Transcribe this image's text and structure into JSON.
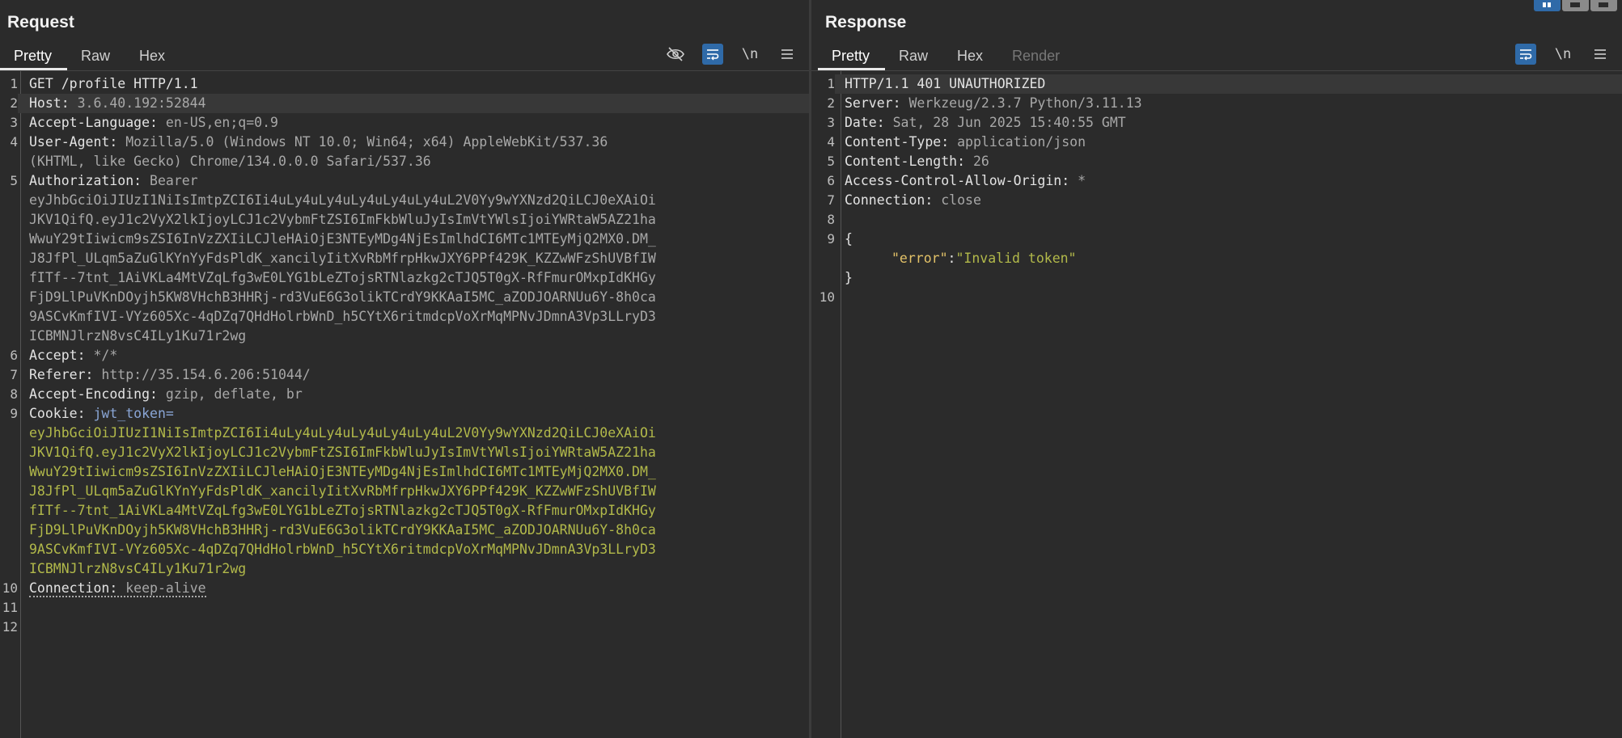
{
  "request": {
    "title": "Request",
    "tabs": [
      "Pretty",
      "Raw",
      "Hex"
    ],
    "active_tab": "Pretty",
    "lines": {
      "l1": "GET /profile HTTP/1.1",
      "l2_name": "Host: ",
      "l2_val": "3.6.40.192:52844",
      "l3_name": "Accept-Language: ",
      "l3_val": "en-US,en;q=0.9",
      "l4_name": "User-Agent: ",
      "l4_val_a": "Mozilla/5.0 (Windows NT 10.0; Win64; x64) AppleWebKit/537.36",
      "l4_val_b": "(KHTML, like Gecko) Chrome/134.0.0.0 Safari/537.36",
      "l5_name": "Authorization: ",
      "l5_val": "Bearer",
      "l5_token": [
        "eyJhbGciOiJIUzI1NiIsImtpZCI6Ii4uLy4uLy4uLy4uLy4uLy4uL2V0Yy9wYXNzd2QiLCJ0eXAiOi",
        "JKV1QifQ.eyJ1c2VyX2lkIjoyLCJ1c2VybmFtZSI6ImFkbWluJyIsImVtYWlsIjoiYWRtaW5AZ21ha",
        "WwuY29tIiwicm9sZSI6InVzZXIiLCJleHAiOjE3NTEyMDg4NjEsImlhdCI6MTc1MTEyMjQ2MX0.DM_",
        "J8JfPl_ULqm5aZuGlKYnYyFdsPldK_xancilyIitXvRbMfrpHkwJXY6PPf429K_KZZwWFzShUVBfIW",
        "fITf--7tnt_1AiVKLa4MtVZqLfg3wE0LYG1bLeZTojsRTNlazkg2cTJQ5T0gX-RfFmurOMxpIdKHGy",
        "FjD9LlPuVKnDOyjh5KW8VHchB3HHRj-rd3VuE6G3olikTCrdY9KKAaI5MC_aZODJOARNUu6Y-8h0ca",
        "9ASCvKmfIVI-VYz605Xc-4qDZq7QHdHolrbWnD_h5CYtX6ritmdcpVoXrMqMPNvJDmnA3Vp3LLryD3",
        "ICBMNJlrzN8vsC4ILy1Ku71r2wg"
      ],
      "l6_name": "Accept: ",
      "l6_val": "*/*",
      "l7_name": "Referer: ",
      "l7_val": "http://35.154.6.206:51044/",
      "l8_name": "Accept-Encoding: ",
      "l8_val": "gzip, deflate, br",
      "l9_name": "Cookie: ",
      "l9_cookie": "jwt_token=",
      "l9_token": [
        "eyJhbGciOiJIUzI1NiIsImtpZCI6Ii4uLy4uLy4uLy4uLy4uLy4uL2V0Yy9wYXNzd2QiLCJ0eXAiOi",
        "JKV1QifQ.eyJ1c2VyX2lkIjoyLCJ1c2VybmFtZSI6ImFkbWluJyIsImVtYWlsIjoiYWRtaW5AZ21ha",
        "WwuY29tIiwicm9sZSI6InVzZXIiLCJleHAiOjE3NTEyMDg4NjEsImlhdCI6MTc1MTEyMjQ2MX0.DM_",
        "J8JfPl_ULqm5aZuGlKYnYyFdsPldK_xancilyIitXvRbMfrpHkwJXY6PPf429K_KZZwWFzShUVBfIW",
        "fITf--7tnt_1AiVKLa4MtVZqLfg3wE0LYG1bLeZTojsRTNlazkg2cTJQ5T0gX-RfFmurOMxpIdKHGy",
        "FjD9LlPuVKnDOyjh5KW8VHchB3HHRj-rd3VuE6G3olikTCrdY9KKAaI5MC_aZODJOARNUu6Y-8h0ca",
        "9ASCvKmfIVI-VYz605Xc-4qDZq7QHdHolrbWnD_h5CYtX6ritmdcpVoXrMqMPNvJDmnA3Vp3LLryD3",
        "ICBMNJlrzN8vsC4ILy1Ku71r2wg"
      ],
      "l10_name": "Connection: ",
      "l10_val": "keep-alive"
    },
    "line_numbers": [
      "1",
      "2",
      "3",
      "4",
      "5",
      "6",
      "7",
      "8",
      "9",
      "10",
      "11",
      "12"
    ]
  },
  "response": {
    "title": "Response",
    "tabs": [
      "Pretty",
      "Raw",
      "Hex",
      "Render"
    ],
    "active_tab": "Pretty",
    "lines": {
      "l1": "HTTP/1.1 401 UNAUTHORIZED",
      "l2_name": "Server: ",
      "l2_val": "Werkzeug/2.3.7 Python/3.11.13",
      "l3_name": "Date: ",
      "l3_val": "Sat, 28 Jun 2025 15:40:55 GMT",
      "l4_name": "Content-Type: ",
      "l4_val": "application/json",
      "l5_name": "Content-Length: ",
      "l5_val": "26",
      "l6_name": "Access-Control-Allow-Origin: ",
      "l6_val": "*",
      "l7_name": "Connection: ",
      "l7_val": "close",
      "l9_open": "{",
      "l9_key": "\"error\"",
      "l9_colon": ":",
      "l9_str": "\"Invalid token\"",
      "l9_close": "}"
    },
    "line_numbers": [
      "1",
      "2",
      "3",
      "4",
      "5",
      "6",
      "7",
      "8",
      "9",
      "10"
    ]
  },
  "toolbar": {
    "newline_label": "\\n",
    "menu_label": "≡"
  },
  "icons": [
    "eye-off-icon",
    "wrap-icon",
    "newline-icon",
    "menu-icon",
    "layout-split-icon",
    "layout-horizontal-icon",
    "layout-single-icon"
  ],
  "colors": {
    "accent": "#2f6aa8",
    "cookie_value": "#b2b94a",
    "json_key": "#e3c268",
    "cookie_name": "#8aa6d6"
  }
}
